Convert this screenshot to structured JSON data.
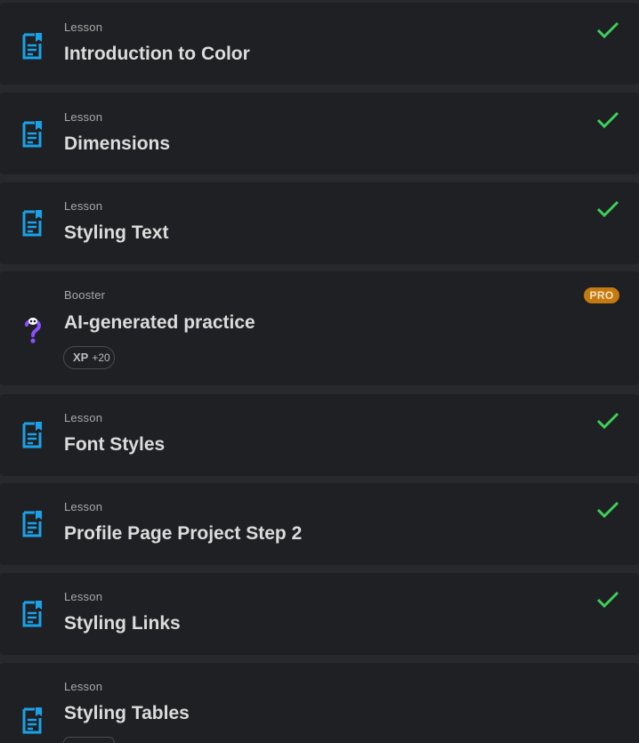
{
  "colors": {
    "background": "#28292d",
    "card": "#1f2023",
    "icon_blue": "#1aa2e8",
    "check_green": "#3ecf5a",
    "pro_orange": "#c47a10",
    "booster_purple": "#8a4fff"
  },
  "items": [
    {
      "type": "Lesson",
      "title": "Introduction to Color",
      "icon": "document-icon",
      "completed": true
    },
    {
      "type": "Lesson",
      "title": "Dimensions",
      "icon": "document-icon",
      "completed": true
    },
    {
      "type": "Lesson",
      "title": "Styling Text",
      "icon": "document-icon",
      "completed": true
    },
    {
      "type": "Booster",
      "title": "AI-generated practice",
      "icon": "question-mark-icon",
      "completed": false,
      "badge": "PRO",
      "xp_label": "XP",
      "xp_value": "+20"
    },
    {
      "type": "Lesson",
      "title": "Font Styles",
      "icon": "document-icon",
      "completed": true
    },
    {
      "type": "Lesson",
      "title": "Profile Page Project Step 2",
      "icon": "document-icon",
      "completed": true
    },
    {
      "type": "Lesson",
      "title": "Styling Links",
      "icon": "document-icon",
      "completed": true
    },
    {
      "type": "Lesson",
      "title": "Styling Tables",
      "icon": "document-icon",
      "completed": false
    }
  ]
}
